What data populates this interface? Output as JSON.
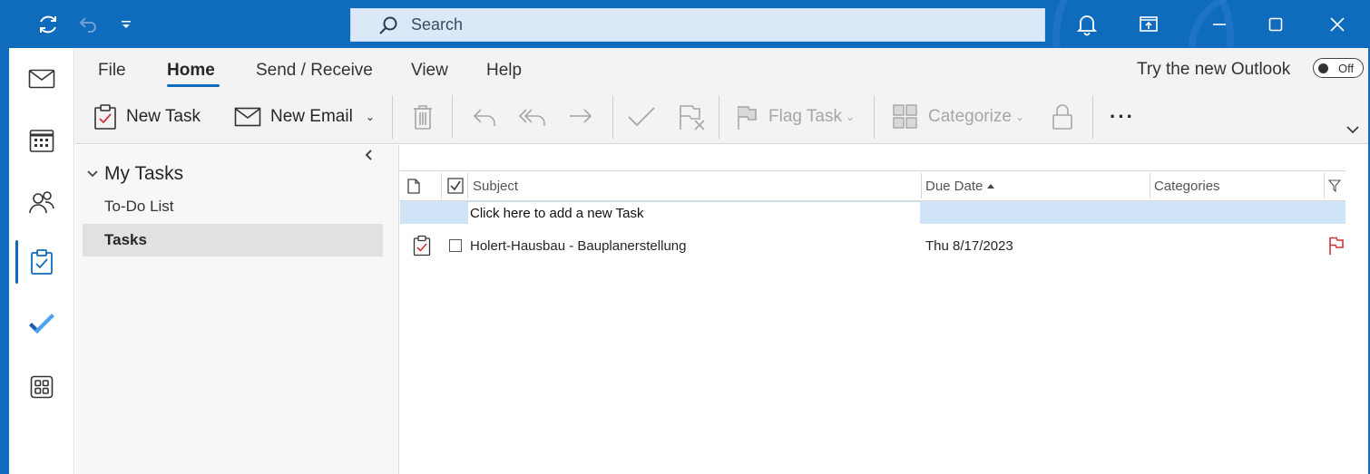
{
  "titlebar": {
    "search_placeholder": "Search"
  },
  "ribbon": {
    "tabs": [
      {
        "label": "File"
      },
      {
        "label": "Home"
      },
      {
        "label": "Send / Receive"
      },
      {
        "label": "View"
      },
      {
        "label": "Help"
      }
    ],
    "try_new_outlook": "Try the new Outlook",
    "toggle_state": "Off",
    "buttons": {
      "new_task": "New Task",
      "new_email": "New Email",
      "flag_task": "Flag Task",
      "categorize": "Categorize",
      "more": "···"
    }
  },
  "folders": {
    "group_label": "My Tasks",
    "items": [
      {
        "label": "To-Do List"
      },
      {
        "label": "Tasks"
      }
    ]
  },
  "tasklist": {
    "columns": {
      "subject": "Subject",
      "due_date": "Due Date",
      "categories": "Categories"
    },
    "new_task_prompt": "Click here to add a new Task",
    "rows": [
      {
        "subject": "Holert-Hausbau - Bauplanerstellung",
        "due_date": "Thu 8/17/2023",
        "flag_color": "#d13438"
      }
    ]
  },
  "colors": {
    "accent": "#0f6cbd",
    "selection": "#cfe4f7"
  }
}
